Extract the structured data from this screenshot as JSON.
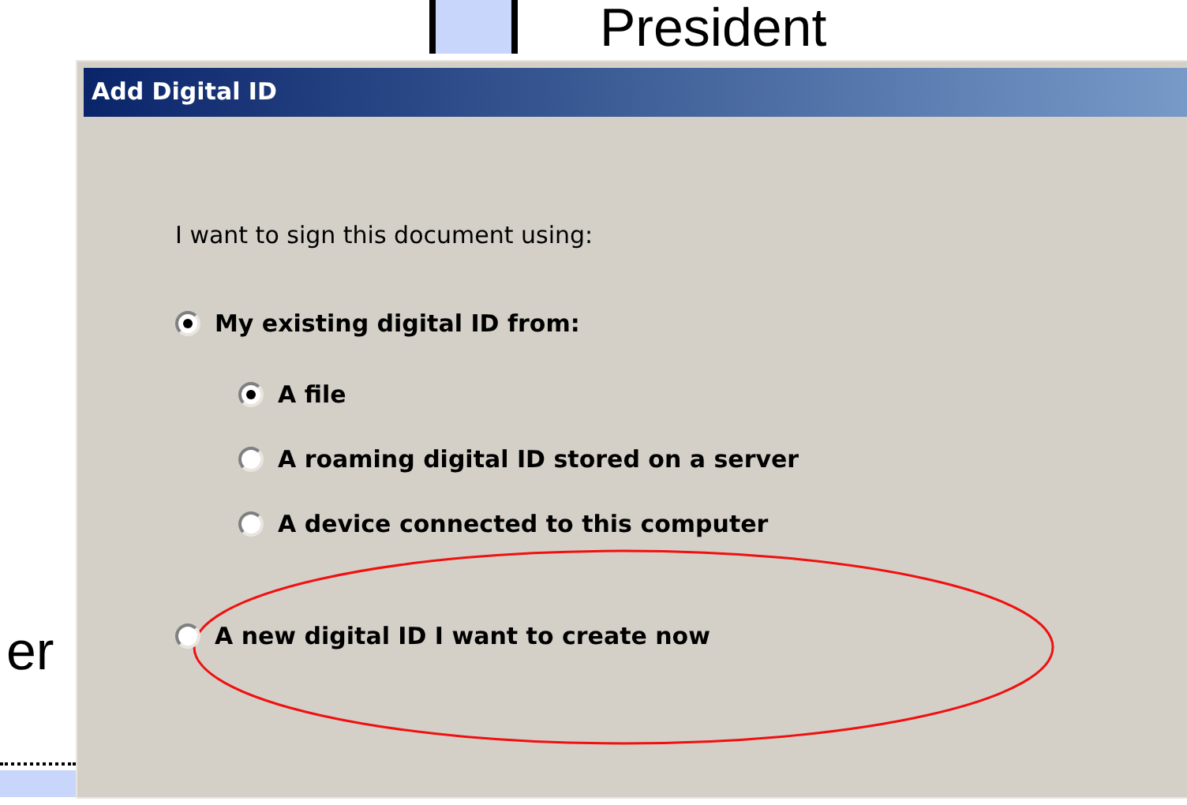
{
  "document": {
    "heading": "President",
    "side_text": "er"
  },
  "dialog": {
    "title": "Add Digital ID",
    "prompt": "I want to sign this document using:",
    "options": [
      {
        "label": "My existing digital ID from:",
        "selected": true,
        "circled": false,
        "children": [
          {
            "label": "A file",
            "selected": true
          },
          {
            "label": "A roaming digital ID stored on a server",
            "selected": false
          },
          {
            "label": "A device connected to this computer",
            "selected": false
          }
        ]
      },
      {
        "label": "A new digital ID I want to create now",
        "selected": false,
        "circled": true
      }
    ]
  }
}
